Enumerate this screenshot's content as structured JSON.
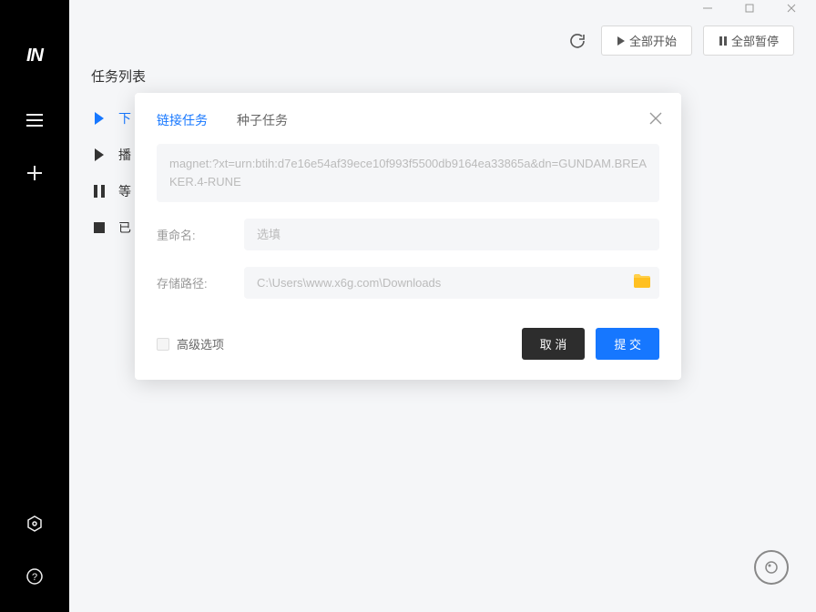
{
  "app": {
    "logo": "IN"
  },
  "toolbar": {
    "start_all": "全部开始",
    "pause_all": "全部暂停"
  },
  "page": {
    "title": "任务列表"
  },
  "tasks": {
    "downloading": "下",
    "seeding": "播",
    "waiting": "等",
    "completed": "已"
  },
  "modal": {
    "tab_link": "链接任务",
    "tab_torrent": "种子任务",
    "magnet": "magnet:?xt=urn:btih:d7e16e54af39ece10f993f5500db9164ea33865a&dn=GUNDAM.BREAKER.4-RUNE",
    "rename_label": "重命名:",
    "rename_placeholder": "选填",
    "path_label": "存储路径:",
    "path_value": "C:\\Users\\www.x6g.com\\Downloads",
    "advanced": "高级选项",
    "cancel": "取 消",
    "submit": "提 交"
  }
}
